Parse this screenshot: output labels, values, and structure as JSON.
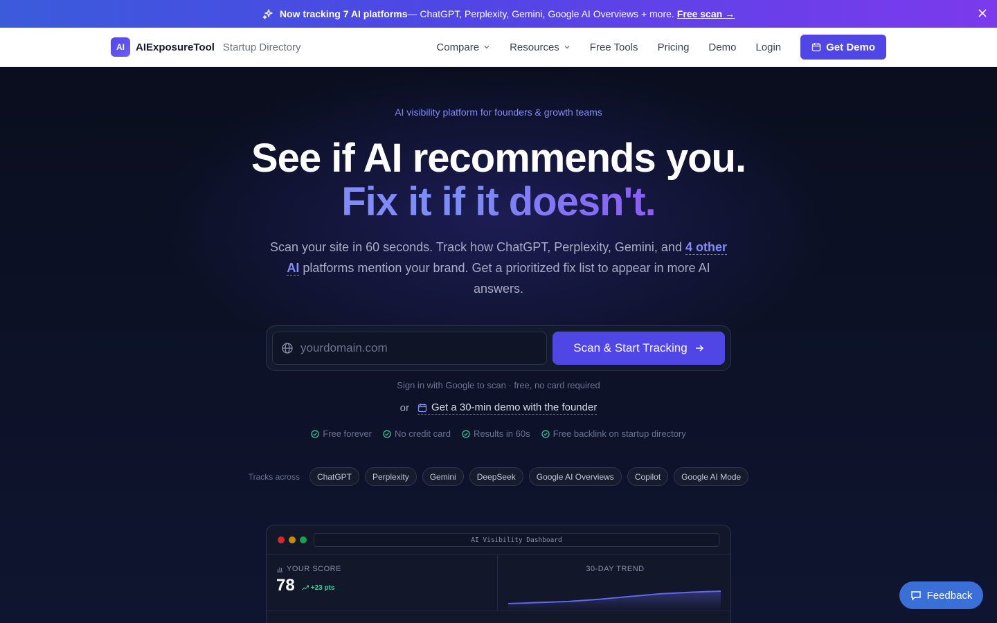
{
  "announcement": {
    "strong": "Now tracking 7 AI platforms",
    "text": " — ChatGPT, Perplexity, Gemini, Google AI Overviews + more.",
    "link": "Free scan →"
  },
  "nav": {
    "logo": "AI",
    "brand": "AIExposureTool",
    "brand_sub": "Startup Directory",
    "links": [
      "Compare",
      "Resources",
      "Free Tools",
      "Pricing",
      "Demo",
      "Login"
    ],
    "cta": "Get Demo"
  },
  "hero": {
    "tagline": "AI visibility platform for founders & growth teams",
    "headline": "See if AI recommends you.",
    "headline_accent": "Fix it if it doesn't.",
    "sub_before": "Scan your site in 60 seconds. Track how ChatGPT, Perplexity, Gemini, and ",
    "sub_highlight": "4 other AI",
    "sub_after": " platforms mention your brand. Get a prioritized fix list to appear in more AI answers.",
    "input_placeholder": "yourdomain.com",
    "scan_button": "Scan & Start Tracking",
    "signin_note": "Sign in with Google to scan · free, no card required",
    "or": "or",
    "demo_link": "Get a 30-min demo with the founder",
    "checks": [
      "Free forever",
      "No credit card",
      "Results in 60s",
      "Free backlink on startup directory"
    ],
    "tracks_label": "Tracks across",
    "platforms": [
      "ChatGPT",
      "Perplexity",
      "Gemini",
      "DeepSeek",
      "Google AI Overviews",
      "Copilot",
      "Google AI Mode"
    ]
  },
  "dashboard": {
    "title": "AI Visibility Dashboard",
    "score_label": "YOUR SCORE",
    "score": "78",
    "delta": "+23 pts",
    "trend_label": "30-DAY TREND",
    "trend_values": [
      10,
      12,
      14,
      18,
      23,
      28,
      31,
      33
    ]
  },
  "feedback": "Feedback",
  "colors": {
    "accent": "#4f46e5",
    "accent_light": "#818cf8",
    "success": "#34d399"
  }
}
